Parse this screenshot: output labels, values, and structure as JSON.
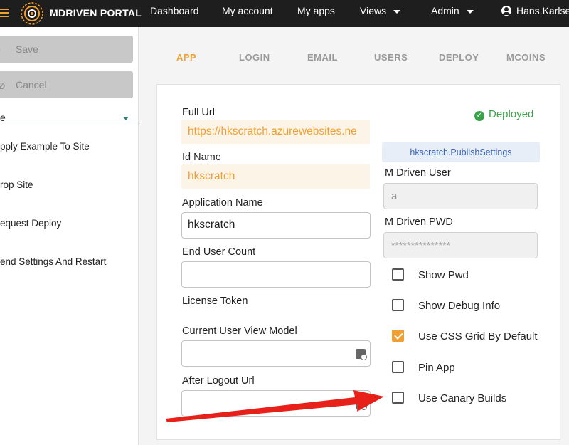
{
  "header": {
    "brand": "MDRIVEN PORTAL",
    "nav": {
      "dashboard": "Dashboard",
      "my_account": "My account",
      "my_apps": "My apps",
      "views": "Views",
      "admin": "Admin",
      "user": "Hans.Karlse"
    }
  },
  "left": {
    "save": "Save",
    "cancel": "Cancel",
    "section": "e",
    "items": [
      "pply Example To Site",
      "rop Site",
      "equest Deploy",
      "end Settings And Restart"
    ]
  },
  "tabs": [
    "APP",
    "LOGIN",
    "EMAIL",
    "USERS",
    "DEPLOY",
    "MCOINS"
  ],
  "form": {
    "full_url_label": "Full Url",
    "full_url_value": "https://hkscratch.azurewebsites.ne",
    "id_name_label": "Id Name",
    "id_name_value": "hkscratch",
    "app_name_label": "Application Name",
    "app_name_value": "hkscratch",
    "end_user_count_label": "End User Count",
    "end_user_count_value": "",
    "license_token_label": "License Token",
    "current_user_vm_label": "Current User View Model",
    "current_user_vm_value": "",
    "after_logout_label": "After Logout Url",
    "after_logout_value": ""
  },
  "right": {
    "status": "Deployed",
    "publish_settings": "hkscratch.PublishSettings",
    "mdriven_user_label": "M Driven User",
    "mdriven_user_value": "a",
    "mdriven_pwd_label": "M Driven PWD",
    "mdriven_pwd_value": "***************",
    "checkboxes": [
      {
        "label": "Show Pwd",
        "checked": false
      },
      {
        "label": "Show Debug Info",
        "checked": false
      },
      {
        "label": "Use CSS Grid By Default",
        "checked": true
      },
      {
        "label": "Pin App",
        "checked": false
      },
      {
        "label": "Use Canary Builds",
        "checked": false
      }
    ]
  },
  "colors": {
    "accent": "#f0a030",
    "topbar": "#1e1e1e",
    "success": "#3aa14a",
    "annotation_arrow": "#e8201a"
  }
}
